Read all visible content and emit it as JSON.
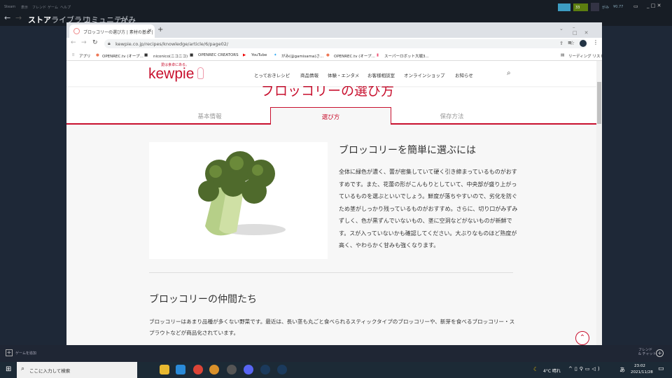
{
  "steam": {
    "menu": [
      "Steam",
      "表示",
      "フレンド",
      "ゲーム",
      "ヘルプ"
    ],
    "nav": [
      "ストア",
      "ライブラリ",
      "コミュニティ",
      "がみ"
    ],
    "user": "がみ",
    "balance": "¥0.77",
    "notifications": "33",
    "add_game": "ゲームを追加",
    "friends_chat": "フレンド\n& チャット"
  },
  "browser": {
    "tab_title": "ブロッコリーの選び方 | 素材の基本 | ",
    "url": "kewpie.co.jp/recipes/knowledge/article/6/page02/",
    "bookmarks": [
      "アプリ",
      "OPENREC.tv (オープ...",
      "niconico(ニコニコ)",
      "OPENREC CREATORS",
      "YouTube",
      "がみ(@gamisama)さ...",
      "OPENREC.tv (オープ...",
      "スーパーロボット大戦3..."
    ],
    "reading_list": "リーディング リスト"
  },
  "site": {
    "tagline": "愛は食卓にある。",
    "logo": "kewpie",
    "nav": [
      "とっておきレシピ",
      "商品情報",
      "体験・エンタメ",
      "お客様相談室",
      "オンラインショップ",
      "お知らせ"
    ],
    "page_title": "ブロッコリーの選び方",
    "tabs": [
      "基本情報",
      "選び方",
      "保存方法"
    ],
    "active_tab": "選び方",
    "section1": {
      "heading": "ブロッコリーを簡単に選ぶには",
      "body": "全体に緑色が濃く、蕾が密集していて硬く引き締まっているものがおすすめです。また、花蕾の形がこんもりとしていて、中央部が盛り上がっているものを選ぶといいでしょう。鮮度が落ちやすいので、劣化を防ぐため茎がしっかり残っているものがおすすめ。さらに、切り口がみずみずしく、色が黒ずんでいないもの、茎に空洞などがないものが新鮮です。スが入っていないかも確認してください。大ぶりなものほど熟度が高く、やわらかく甘みも強くなります。"
    },
    "section2": {
      "heading": "ブロッコリーの仲間たち",
      "body": "ブロッコリーはあまり品種が多くない野菜です。最近は、長い茎も丸ごと食べられるスティックタイプのブロッコリーや、新芽を食べるブロッコリー・スプラウトなどが商品化されています。"
    },
    "brand_color": "#c8102e"
  },
  "taskbar": {
    "search_placeholder": "ここに入力して検索",
    "weather": "4°C 晴れ",
    "ime": "あ",
    "time": "23:02",
    "date": "2021/11/28"
  }
}
